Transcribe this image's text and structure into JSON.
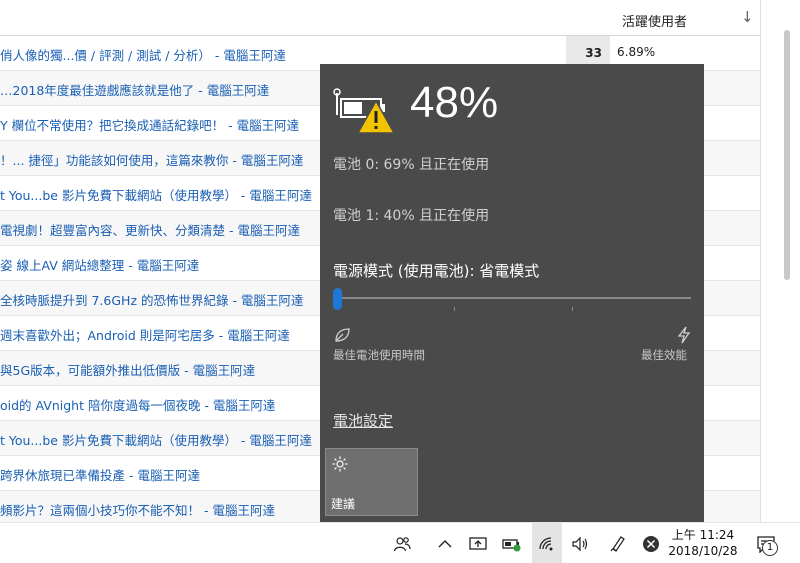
{
  "table": {
    "header_label": "活躍使用者",
    "sort_icon": "arrow-down-icon",
    "rows": [
      {
        "title": "俏人像的獨...價 / 評測 / 測試 / 分析） - 電腦王阿達",
        "count": "33",
        "pct": "6.89%"
      },
      {
        "title": "…2018年度最佳遊戲應該就是他了 - 電腦王阿達",
        "count": "",
        "pct": ""
      },
      {
        "title": "Y 欄位不常使用？把它換成通話紀錄吧！ - 電腦王阿達",
        "count": "",
        "pct": ""
      },
      {
        "title": "！... 捷徑」功能該如何使用，這篇來教你 - 電腦王阿達",
        "count": "",
        "pct": ""
      },
      {
        "title": "t You...be 影片免費下載網站（使用教學） - 電腦王阿達",
        "count": "",
        "pct": ""
      },
      {
        "title": "電視劇！超豐富內容、更新快、分類清楚 - 電腦王阿達",
        "count": "",
        "pct": ""
      },
      {
        "title": "姿 線上AV 網站總整理 - 電腦王阿達",
        "count": "",
        "pct": ""
      },
      {
        "title": "全核時脈提升到 7.6GHz 的恐怖世界紀錄 - 電腦王阿達",
        "count": "",
        "pct": ""
      },
      {
        "title": "週末喜歡外出；Android 則是阿宅居多 - 電腦王阿達",
        "count": "",
        "pct": ""
      },
      {
        "title": "與5G版本，可能額外推出低價版 - 電腦王阿達",
        "count": "",
        "pct": ""
      },
      {
        "title": "oid的 AVnight 陪你度過每一個夜晚 - 電腦王阿達",
        "count": "",
        "pct": ""
      },
      {
        "title": "t You...be 影片免費下載網站（使用教學） - 電腦王阿達",
        "count": "",
        "pct": ""
      },
      {
        "title": "跨界休旅現已準備投產 - 電腦王阿達",
        "count": "",
        "pct": ""
      },
      {
        "title": "頻影片？這兩個小技巧你不能不知！ - 電腦王阿達",
        "count": "",
        "pct": ""
      }
    ]
  },
  "flyout": {
    "battery_icon": "battery-warning-icon",
    "percent": "48%",
    "battery0": "電池 0: 69% 且正在使用",
    "battery1": "電池 1: 40% 且正在使用",
    "power_mode": "電源模式 (使用電池): 省電模式",
    "slider_level": 0,
    "left_label": "最佳電池使用時間",
    "right_label": "最佳效能",
    "left_icon": "leaf-icon",
    "right_icon": "lightning-icon",
    "settings_link": "電池設定",
    "tile_label": "建議",
    "tile_icon": "brightness-icon",
    "accent": "#1e78d7"
  },
  "taskbar": {
    "icons": [
      "people-icon",
      "chevron-up-icon",
      "display-icon",
      "battery-icon",
      "wifi-icon",
      "volume-icon",
      "pen-icon",
      "close-circle-icon"
    ],
    "time": "上午 11:24",
    "date": "2018/10/28",
    "notification_icon": "notification-icon",
    "notification_count": "1"
  }
}
